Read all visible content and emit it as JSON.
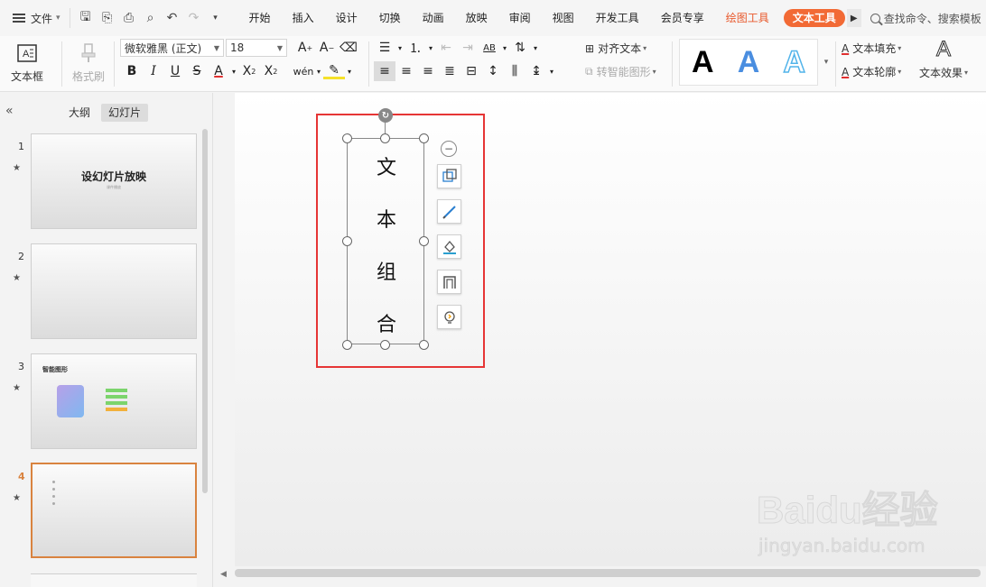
{
  "menubar": {
    "file_label": "文件",
    "tabs": [
      "开始",
      "插入",
      "设计",
      "切换",
      "动画",
      "放映",
      "审阅",
      "视图",
      "开发工具",
      "会员专享"
    ],
    "drawing_tools": "绘图工具",
    "text_tools": "文本工具",
    "search_label": "查找命令、搜索模板"
  },
  "ribbon": {
    "textbox_label": "文本框",
    "format_painter_label": "格式刷",
    "font_name": "微软雅黑 (正文)",
    "font_size": "18",
    "align_text_label": "对齐文本",
    "smartart_label": "转智能图形",
    "text_fill_label": "文本填充",
    "text_outline_label": "文本轮廓",
    "text_effect_label": "文本效果",
    "wordart_letter": "A"
  },
  "panel": {
    "outline_tab": "大纲",
    "slides_tab": "幻灯片",
    "slides": [
      {
        "num": "1",
        "title": "设幻灯片放映",
        "subtitle": "课件播放"
      },
      {
        "num": "2",
        "title": ""
      },
      {
        "num": "3",
        "title": "智能图形"
      },
      {
        "num": "4",
        "title": ""
      }
    ],
    "star": "★"
  },
  "canvas": {
    "vertical_text": [
      "文",
      "本",
      "组",
      "合"
    ]
  },
  "watermark": {
    "brand": "Baidu经验",
    "url": "jingyan.baidu.com"
  },
  "colors": {
    "accent_orange": "#f26a35",
    "selection_red": "#e63535",
    "wordart_blue": "#4a8ee0"
  }
}
